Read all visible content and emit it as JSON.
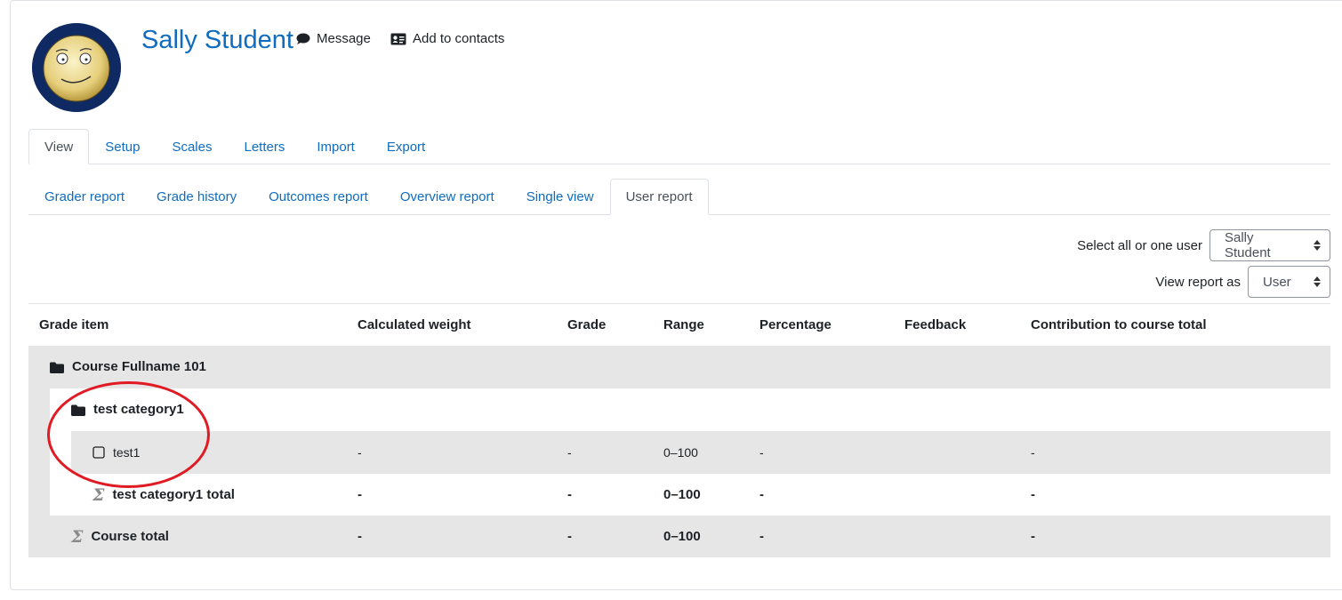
{
  "header": {
    "user_name": "Sally Student",
    "message_label": "Message",
    "add_contacts_label": "Add to contacts"
  },
  "primary_tabs": [
    "View",
    "Setup",
    "Scales",
    "Letters",
    "Import",
    "Export"
  ],
  "primary_active": "View",
  "secondary_tabs": [
    "Grader report",
    "Grade history",
    "Outcomes report",
    "Overview report",
    "Single view",
    "User report"
  ],
  "secondary_active": "User report",
  "selectors": {
    "user_label": "Select all or one user",
    "user_value": "Sally Student",
    "view_label": "View report as",
    "view_value": "User"
  },
  "table": {
    "headers": [
      "Grade item",
      "Calculated weight",
      "Grade",
      "Range",
      "Percentage",
      "Feedback",
      "Contribution to course total"
    ],
    "rows": [
      {
        "item": "Course Fullname 101",
        "icon": "folder-icon",
        "weight": "",
        "grade": "",
        "range": "",
        "percentage": "",
        "feedback": "",
        "contribution": ""
      },
      {
        "item": "test category1",
        "icon": "folder-icon",
        "weight": "",
        "grade": "",
        "range": "",
        "percentage": "",
        "feedback": "",
        "contribution": ""
      },
      {
        "item": "test1",
        "icon": "checkbox-icon",
        "weight": "-",
        "grade": "-",
        "range": "0–100",
        "percentage": "-",
        "feedback": "",
        "contribution": "-"
      },
      {
        "item": "test category1 total",
        "icon": "sigma-icon",
        "weight": "-",
        "grade": "-",
        "range": "0–100",
        "percentage": "-",
        "feedback": "",
        "contribution": "-"
      },
      {
        "item": "Course total",
        "icon": "sigma-icon",
        "weight": "-",
        "grade": "-",
        "range": "0–100",
        "percentage": "-",
        "feedback": "",
        "contribution": "-"
      }
    ]
  },
  "colors": {
    "link": "#0f6cbf",
    "row_gray": "#e6e6e6",
    "annotation": "#e01b24"
  }
}
